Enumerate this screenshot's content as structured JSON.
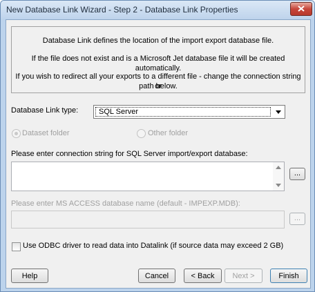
{
  "window": {
    "title": "New Database Link Wizard - Step 2 - Database Link Properties"
  },
  "info": {
    "line1": "Database Link defines the location of the import export database file.",
    "line2": "If the file does not exist and is a Microsoft Jet database file it will be created automatically.",
    "line3a": "If you wish to redirect all your exports to a different file - change the connection string or",
    "line3b": "path below."
  },
  "link_type": {
    "label": "Database Link type:",
    "selected": "SQL Server"
  },
  "radios": {
    "dataset_folder": "Dataset folder",
    "other_folder": "Other folder"
  },
  "connection": {
    "label": "Please enter connection string for SQL Server import/export database:",
    "value": "",
    "browse": "..."
  },
  "access": {
    "label": "Please enter MS ACCESS database name (default - IMPEXP.MDB):",
    "value": "",
    "browse": "..."
  },
  "odbc": {
    "label": "Use ODBC driver to read data into Datalink (if source data may exceed 2 GB)",
    "checked": false
  },
  "buttons": {
    "help": "Help",
    "cancel": "Cancel",
    "back": "< Back",
    "next": "Next >",
    "finish": "Finish"
  },
  "colors": {
    "title_bar": "#bfd4ec",
    "dialog_bg": "#f0f0f0",
    "close": "#c7463a",
    "disabled_text": "#a0a0a0"
  },
  "icons": {
    "close": "close-icon",
    "dropdown": "chevron-down-icon",
    "scroll_up": "scroll-up-icon",
    "scroll_down": "scroll-down-icon"
  }
}
